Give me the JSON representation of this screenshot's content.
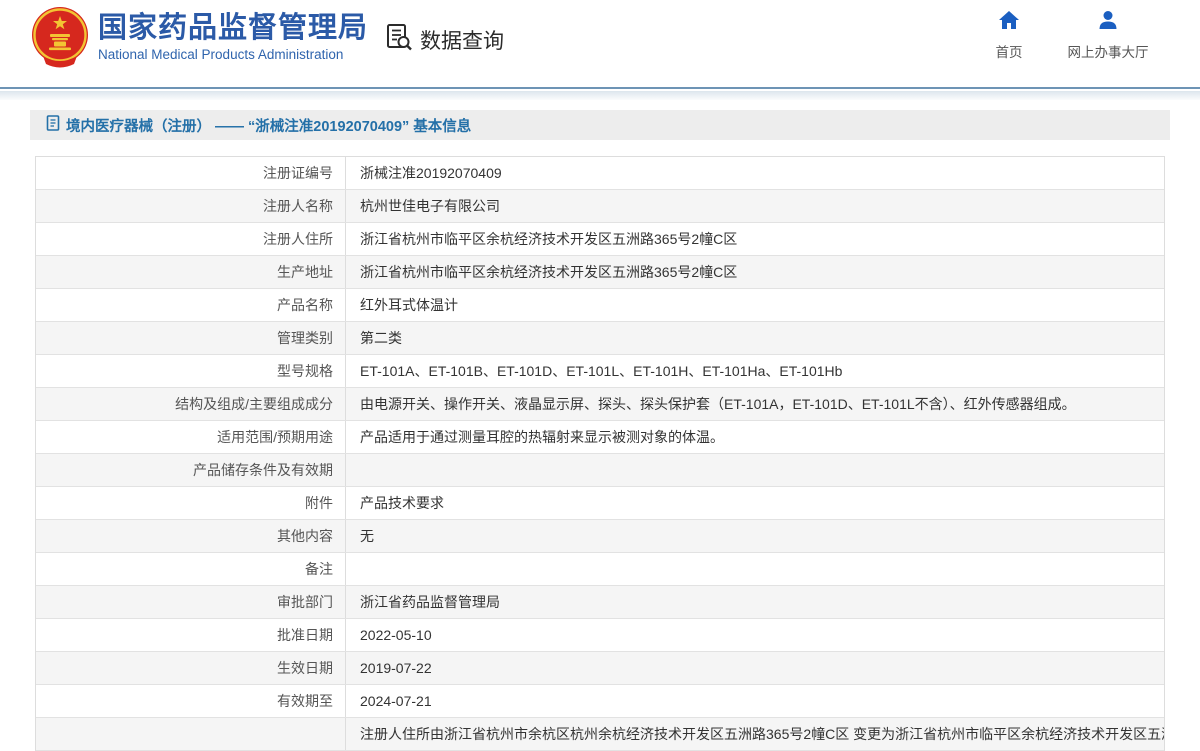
{
  "header": {
    "logo_icon": "national-emblem",
    "org_name_cn": "国家药品监督管理局",
    "org_name_en": "National Medical Products Administration",
    "nav": {
      "data_query": {
        "label": "数据查询",
        "icon": "document-search-icon"
      },
      "home": {
        "label": "首页",
        "icon": "home-icon"
      },
      "service_hall": {
        "label": "网上办事大厅",
        "icon": "user-icon"
      }
    }
  },
  "breadcrumb": {
    "icon": "document-icon",
    "title": "境内医疗器械（注册） —— “浙械注准20192070409” 基本信息"
  },
  "detail_table": {
    "rows": [
      {
        "label": "注册证编号",
        "value": "浙械注准20192070409"
      },
      {
        "label": "注册人名称",
        "value": "杭州世佳电子有限公司"
      },
      {
        "label": "注册人住所",
        "value": "浙江省杭州市临平区余杭经济技术开发区五洲路365号2幢C区"
      },
      {
        "label": "生产地址",
        "value": "浙江省杭州市临平区余杭经济技术开发区五洲路365号2幢C区"
      },
      {
        "label": "产品名称",
        "value": "红外耳式体温计"
      },
      {
        "label": "管理类别",
        "value": "第二类"
      },
      {
        "label": "型号规格",
        "value": "ET-101A、ET-101B、ET-101D、ET-101L、ET-101H、ET-101Ha、ET-101Hb"
      },
      {
        "label": "结构及组成/主要组成成分",
        "value": "由电源开关、操作开关、液晶显示屏、探头、探头保护套（ET-101A，ET-101D、ET-101L不含）、红外传感器组成。"
      },
      {
        "label": "适用范围/预期用途",
        "value": "产品适用于通过测量耳腔的热辐射来显示被测对象的体温。"
      },
      {
        "label": "产品储存条件及有效期",
        "value": ""
      },
      {
        "label": "附件",
        "value": "产品技术要求"
      },
      {
        "label": "其他内容",
        "value": "无"
      },
      {
        "label": "备注",
        "value": ""
      },
      {
        "label": "审批部门",
        "value": "浙江省药品监督管理局"
      },
      {
        "label": "批准日期",
        "value": "2022-05-10"
      },
      {
        "label": "生效日期",
        "value": "2019-07-22"
      },
      {
        "label": "有效期至",
        "value": "2024-07-21"
      },
      {
        "label": "",
        "value": "注册人住所由浙江省杭州市余杭区杭州余杭经济技术开发区五洲路365号2幢C区 变更为浙江省杭州市临平区余杭经济技术开发区五洲"
      }
    ]
  },
  "colors": {
    "brand_blue": "#2b5aa7",
    "link_blue": "#2470a8",
    "icon_blue": "#1b5fc1",
    "header_rule": "#6d94b5",
    "breadcrumb_bg": "#ededed",
    "table_border": "#dddddd",
    "row_alt_bg": "#f5f5f5",
    "emblem_red": "#d6281e",
    "emblem_gold": "#f3c433"
  }
}
